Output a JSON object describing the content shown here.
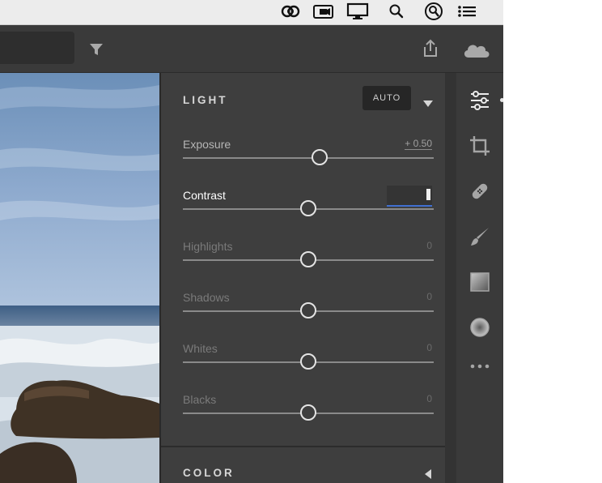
{
  "menubar": {
    "icons": [
      "creative-cloud-icon",
      "video-camera-icon",
      "display-icon",
      "search-icon",
      "spotlight-icon",
      "list-icon"
    ]
  },
  "toolbar": {
    "icons": [
      "filter-icon",
      "share-icon",
      "cloud-icon"
    ]
  },
  "light": {
    "title": "LIGHT",
    "auto_label": "AUTO",
    "sliders": [
      {
        "label": "Exposure",
        "value": "+ 0.50",
        "position": 0.545
      },
      {
        "label": "Contrast",
        "value": "",
        "position": 0.5
      },
      {
        "label": "Highlights",
        "value": "0",
        "position": 0.5
      },
      {
        "label": "Shadows",
        "value": "0",
        "position": 0.5
      },
      {
        "label": "Whites",
        "value": "0",
        "position": 0.5
      },
      {
        "label": "Blacks",
        "value": "0",
        "position": 0.5
      }
    ]
  },
  "color": {
    "title": "COLOR"
  },
  "tools": [
    "sliders-icon",
    "crop-icon",
    "healing-bandage-icon",
    "brush-icon",
    "linear-gradient-icon",
    "radial-gradient-icon",
    "more-icon"
  ],
  "colors": {
    "panel": "#3e3e3e",
    "accent": "#3f6fd0",
    "text": "#b5b5b5"
  }
}
